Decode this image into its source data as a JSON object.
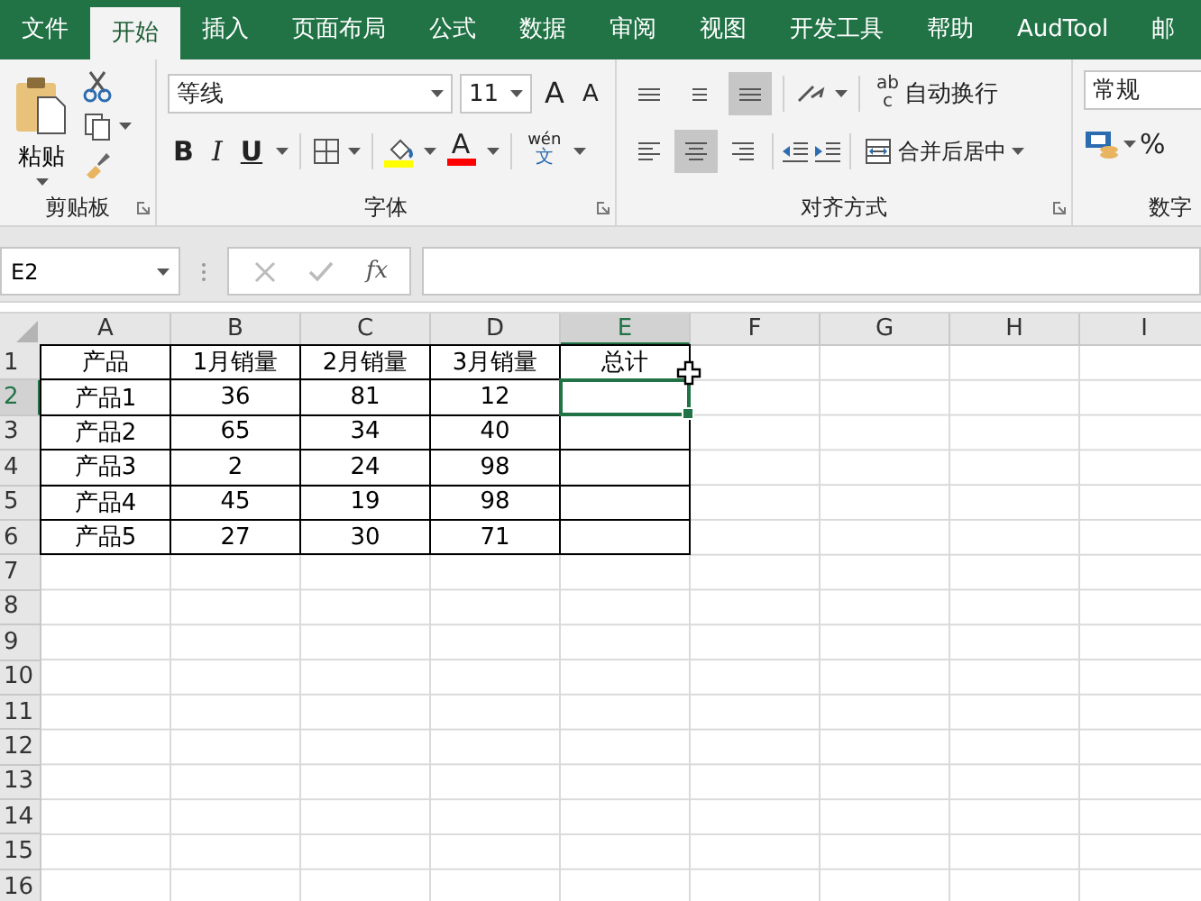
{
  "tabs": [
    {
      "label": "文件",
      "selected": false
    },
    {
      "label": "开始",
      "selected": true
    },
    {
      "label": "插入",
      "selected": false
    },
    {
      "label": "页面布局",
      "selected": false
    },
    {
      "label": "公式",
      "selected": false
    },
    {
      "label": "数据",
      "selected": false
    },
    {
      "label": "审阅",
      "selected": false
    },
    {
      "label": "视图",
      "selected": false
    },
    {
      "label": "开发工具",
      "selected": false
    },
    {
      "label": "帮助",
      "selected": false
    },
    {
      "label": "AudTool",
      "selected": false
    },
    {
      "label": "邮",
      "selected": false
    }
  ],
  "ribbon": {
    "clipboard": {
      "paste": "粘贴",
      "group_label": "剪贴板"
    },
    "font": {
      "font_name": "等线",
      "font_size": "11",
      "grow": "A",
      "shrink": "A",
      "bold": "B",
      "italic": "I",
      "underline": "U",
      "font_color": "A",
      "phonetic_top": "wén",
      "phonetic_bottom": "文",
      "group_label": "字体"
    },
    "alignment": {
      "buttons": [
        {
          "kind": "top",
          "selected": false
        },
        {
          "kind": "middle",
          "selected": false
        },
        {
          "kind": "bottom",
          "selected": true
        },
        {
          "kind": "left",
          "selected": false
        },
        {
          "kind": "center",
          "selected": true
        },
        {
          "kind": "right",
          "selected": false
        }
      ],
      "wrap_icon_top": "ab",
      "wrap_icon_bottom": "c",
      "wrap_text": "自动换行",
      "merge_center": "合并后居中",
      "group_label": "对齐方式"
    },
    "number": {
      "format": "常规",
      "percent": "%",
      "group_label": "数字"
    }
  },
  "formula_bar": {
    "name_box": "E2",
    "fx": "fx"
  },
  "sheet": {
    "columns": [
      {
        "label": "A",
        "selected": false
      },
      {
        "label": "B",
        "selected": false
      },
      {
        "label": "C",
        "selected": false
      },
      {
        "label": "D",
        "selected": false
      },
      {
        "label": "E",
        "selected": true
      },
      {
        "label": "F",
        "selected": false
      },
      {
        "label": "G",
        "selected": false
      },
      {
        "label": "H",
        "selected": false
      },
      {
        "label": "I",
        "selected": false
      }
    ],
    "rows": [
      {
        "label": "1",
        "selected": false,
        "cells": [
          {
            "text": "产品",
            "bordered": true
          },
          {
            "text": "1月销量",
            "bordered": true
          },
          {
            "text": "2月销量",
            "bordered": true
          },
          {
            "text": "3月销量",
            "bordered": true
          },
          {
            "text": "总计",
            "bordered": true
          }
        ]
      },
      {
        "label": "2",
        "selected": true,
        "cells": [
          {
            "text": "产品1",
            "bordered": true
          },
          {
            "text": "36",
            "bordered": true
          },
          {
            "text": "81",
            "bordered": true
          },
          {
            "text": "12",
            "bordered": true
          },
          {
            "bordered": true
          }
        ]
      },
      {
        "label": "3",
        "selected": false,
        "cells": [
          {
            "text": "产品2",
            "bordered": true
          },
          {
            "text": "65",
            "bordered": true
          },
          {
            "text": "34",
            "bordered": true
          },
          {
            "text": "40",
            "bordered": true
          },
          {
            "bordered": true
          }
        ]
      },
      {
        "label": "4",
        "selected": false,
        "cells": [
          {
            "text": "产品3",
            "bordered": true
          },
          {
            "text": "2",
            "bordered": true
          },
          {
            "text": "24",
            "bordered": true
          },
          {
            "text": "98",
            "bordered": true
          },
          {
            "bordered": true
          }
        ]
      },
      {
        "label": "5",
        "selected": false,
        "cells": [
          {
            "text": "产品4",
            "bordered": true
          },
          {
            "text": "45",
            "bordered": true
          },
          {
            "text": "19",
            "bordered": true
          },
          {
            "text": "98",
            "bordered": true
          },
          {
            "bordered": true
          }
        ]
      },
      {
        "label": "6",
        "selected": false,
        "cells": [
          {
            "text": "产品5",
            "bordered": true
          },
          {
            "text": "27",
            "bordered": true
          },
          {
            "text": "30",
            "bordered": true
          },
          {
            "text": "71",
            "bordered": true
          },
          {
            "bordered": true
          }
        ]
      },
      {
        "label": "7",
        "selected": false
      },
      {
        "label": "8",
        "selected": false
      },
      {
        "label": "9",
        "selected": false
      },
      {
        "label": "10",
        "selected": false
      },
      {
        "label": "11",
        "selected": false
      },
      {
        "label": "12",
        "selected": false
      },
      {
        "label": "13",
        "selected": false
      },
      {
        "label": "14",
        "selected": false
      },
      {
        "label": "15",
        "selected": false
      },
      {
        "label": "16",
        "selected": false
      }
    ]
  }
}
